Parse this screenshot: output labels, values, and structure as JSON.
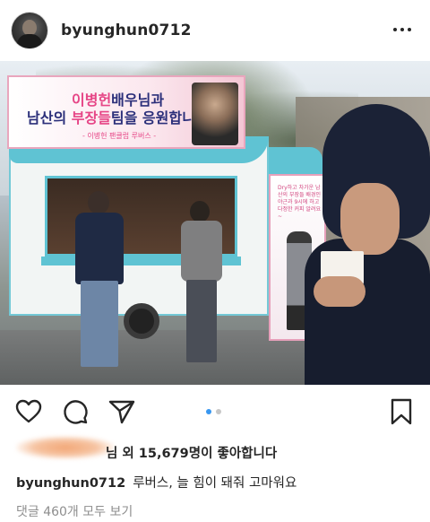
{
  "header": {
    "username": "byunghun0712",
    "more_icon": "more-horizontal-icon"
  },
  "photo": {
    "banner_line1_highlight": "이병헌",
    "banner_line1_rest": "배우님과",
    "banner_line2_a": "남산의 ",
    "banner_line2_highlight": "부장들",
    "banner_line2_b": "팀을 응원합니다.",
    "banner_sub": "- 이병헌 팬클럽 루버스 -",
    "standee_text": "Dry하고 차가운 남산의 부장들 배경인 야근과 9시에 하고 다정한 커피 알려요~"
  },
  "actions": {
    "like_icon": "heart-icon",
    "comment_icon": "comment-icon",
    "share_icon": "send-icon",
    "save_icon": "bookmark-icon",
    "carousel_total": 2,
    "carousel_active": 1
  },
  "likes": {
    "prefix": "님 외 ",
    "count": "15,679",
    "suffix": "명이 좋아합니다"
  },
  "caption": {
    "username": "byunghun0712",
    "text": "루버스, 늘 힘이 돼줘 고마워요"
  },
  "comments": {
    "view_all": "댓글 460개 모두 보기"
  },
  "colors": {
    "link_blue": "#3897f0",
    "text": "#262626",
    "muted": "#8e8e8e",
    "truck_teal": "#5fc3d3",
    "banner_pink": "#e64586",
    "banner_navy": "#2b2f7a"
  }
}
